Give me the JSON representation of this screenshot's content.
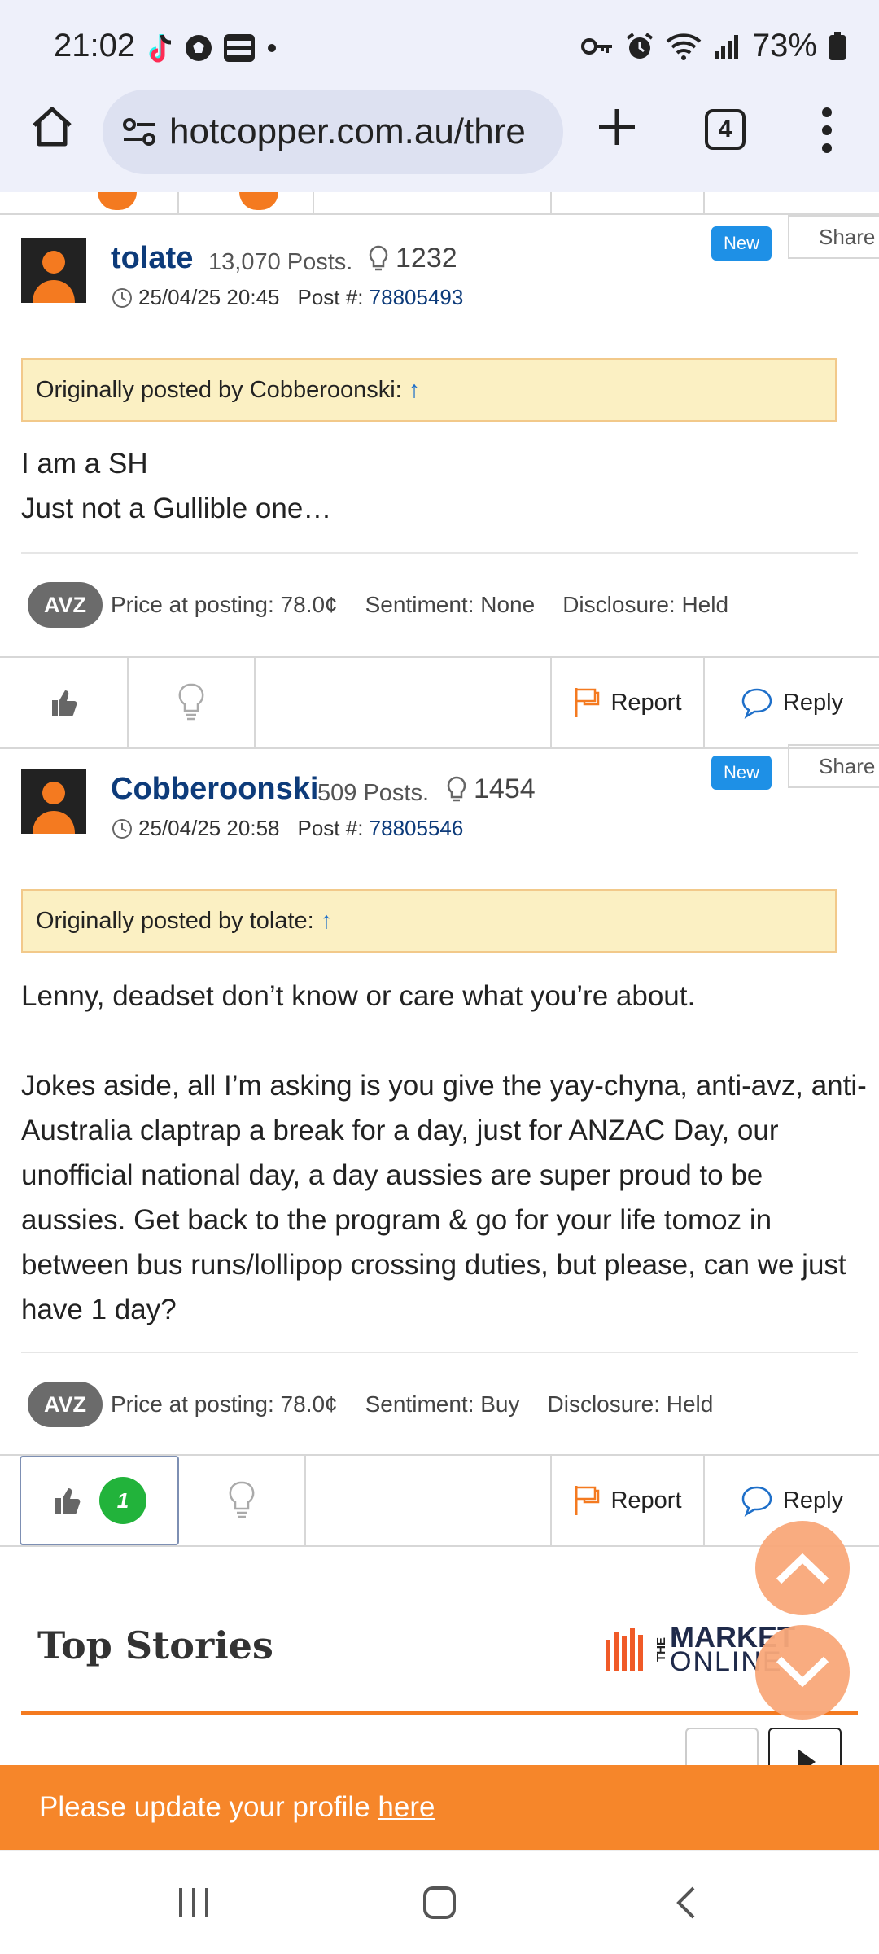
{
  "status_bar": {
    "time": "21:02",
    "battery": "73%"
  },
  "browser": {
    "url": "hotcopper.com.au/thre",
    "tab_count": "4"
  },
  "posts": [
    {
      "author": "tolate",
      "post_count": "13,070 Posts.",
      "likes": "1232",
      "date": "25/04/25 20:45",
      "post_label": "Post #:",
      "post_number": "78805493",
      "new_badge": "New",
      "share_label": "Share",
      "quote_prefix": "Originally posted by Cobberoonski:",
      "quote_arrow": "↑",
      "body": "I am a SH\nJust not a Gullible one…",
      "ticker": "AVZ",
      "price": "Price at posting: 78.0¢",
      "sentiment": "Sentiment: None",
      "disclosure": "Disclosure: Held",
      "report_label": "Report",
      "reply_label": "Reply"
    },
    {
      "author": "Cobberoonski",
      "post_count": "509 Posts.",
      "likes": "1454",
      "date": "25/04/25 20:58",
      "post_label": "Post #:",
      "post_number": "78805546",
      "new_badge": "New",
      "share_label": "Share",
      "quote_prefix": "Originally posted by tolate:",
      "quote_arrow": "↑",
      "body": "Lenny, deadset don’t know or care what you’re about.\n\nJokes aside, all I’m asking is you give the yay-chyna, anti-avz, anti-Australia claptrap a break for a day, just for ANZAC Day, our unofficial national day, a day aussies are super proud to be aussies. Get back to the program & go for your life tomoz in between bus runs/lollipop crossing duties, but please, can we just have 1 day?",
      "ticker": "AVZ",
      "price": "Price at posting: 78.0¢",
      "sentiment": "Sentiment: Buy",
      "disclosure": "Disclosure: Held",
      "thumbs_count": "1",
      "report_label": "Report",
      "reply_label": "Reply"
    }
  ],
  "top_stories": {
    "title": "Top Stories",
    "logo_the": "THE",
    "logo_market": "MARKET",
    "logo_online": "ONLINE"
  },
  "banner": {
    "text": "Please update your profile ",
    "link": "here"
  },
  "colors": {
    "brand_orange": "#f6862a",
    "link_blue": "#0d3b7a",
    "new_blue": "#1e90e6",
    "quote_bg": "#fbf0c3",
    "like_green": "#22b33b"
  },
  "icons": [
    "tiktok-icon",
    "soccer-ball-icon",
    "optus-sport-icon",
    "key-icon",
    "alarm-icon",
    "wifi-icon",
    "signal-icon",
    "battery-icon",
    "home-icon",
    "settings-sliders-icon",
    "plus-icon",
    "more-icon",
    "clock-icon",
    "lightbulb-icon",
    "thumbs-up-icon",
    "flag-icon",
    "reply-bubble-icon",
    "chevron-up-icon",
    "chevron-down-icon",
    "recent-apps-icon",
    "home-nav-icon",
    "back-icon"
  ]
}
